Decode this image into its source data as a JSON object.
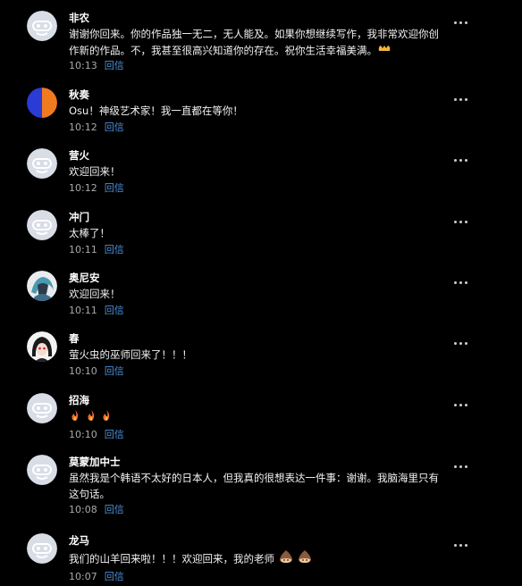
{
  "comments": [
    {
      "name": "非农",
      "text": "谢谢你回来。你的作品独一无二，无人能及。如果你想继续写作，我非常欢迎你创作新的作品。不，我甚至很高兴知道你的存在。祝你生活幸福美满。",
      "emoji": "hands-icon",
      "time": "10:13",
      "reply": "回信",
      "avatar": "default-robot-avatar"
    },
    {
      "name": "秋奏",
      "text": "Osu！神级艺术家！我一直都在等你！",
      "time": "10:12",
      "reply": "回信",
      "avatar": "blue-orange-circle-avatar"
    },
    {
      "name": "营火",
      "text": "欢迎回来！",
      "time": "10:12",
      "reply": "回信",
      "avatar": "default-robot-avatar"
    },
    {
      "name": "冲门",
      "text": "太棒了！",
      "time": "10:11",
      "reply": "回信",
      "avatar": "default-robot-avatar"
    },
    {
      "name": "奥尼安",
      "text": "欢迎回来！",
      "time": "10:11",
      "reply": "回信",
      "avatar": "anime-character-avatar"
    },
    {
      "name": "春",
      "text": "萤火虫的巫师回来了！！！",
      "time": "10:10",
      "reply": "回信",
      "avatar": "anime-girl-avatar"
    },
    {
      "name": "招海",
      "text": "",
      "emoji_count": 3,
      "emoji": "fire-icon",
      "time": "10:10",
      "reply": "回信",
      "avatar": "default-robot-avatar"
    },
    {
      "name": "莫蒙加中士",
      "text": "虽然我是个韩语不太好的日本人，但我真的很想表达一件事：谢谢。我脑海里只有这句话。",
      "time": "10:08",
      "reply": "回信",
      "avatar": "default-robot-avatar"
    },
    {
      "name": "龙马",
      "text": "我们的山羊回来啦！！！欢迎回来，我的老师",
      "emoji_count": 2,
      "emoji": "chestnut-face-icon",
      "time": "10:07",
      "reply": "回信",
      "avatar": "default-robot-avatar"
    }
  ],
  "colors": {
    "background": "#000000",
    "name": "#ffffff",
    "text": "#f2f2f2",
    "time": "#a9a9a9",
    "reply": "#4d8fd6",
    "default_avatar_bg": "#d8dde6",
    "fire": "#f26b2c",
    "chestnut": "#8a5a3c"
  }
}
